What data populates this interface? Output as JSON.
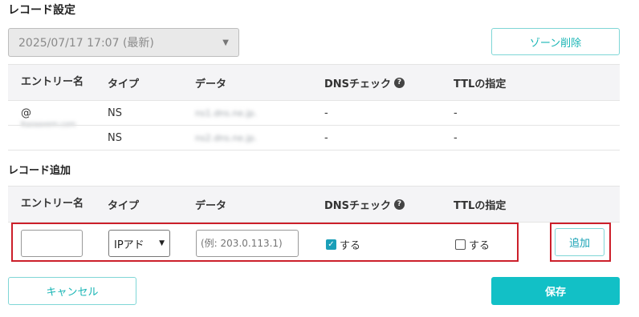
{
  "page": {
    "title": "レコード設定",
    "version_select": "2025/07/17 17:07 (最新)",
    "zone_delete": "ゾーン削除"
  },
  "columns": {
    "entry": "エントリー名",
    "type": "タイプ",
    "data": "データ",
    "dns": "DNSチェック",
    "ttl": "TTLの指定"
  },
  "records": {
    "entry": "@",
    "entry_sub": "Kazaaxem.com",
    "rows": [
      {
        "type": "NS",
        "data": "ns1.dns.ne.jp.",
        "dns": "-",
        "ttl": "-"
      },
      {
        "type": "NS",
        "data": "ns2.dns.ne.jp.",
        "dns": "-",
        "ttl": "-"
      }
    ]
  },
  "add_section": {
    "title": "レコード追加",
    "entry_value": "",
    "type_selected": "IPアド",
    "data_placeholder": "(例: 203.0.113.1)",
    "dns_check_label": "する",
    "dns_checked": true,
    "ttl_label": "する",
    "ttl_checked": false,
    "add_button": "追加"
  },
  "footer": {
    "cancel": "キャンセル",
    "save": "保存"
  },
  "colors": {
    "accent": "#12c0c6",
    "highlight_border": "#cc1f2a",
    "checkbox": "#1a9fb8"
  }
}
